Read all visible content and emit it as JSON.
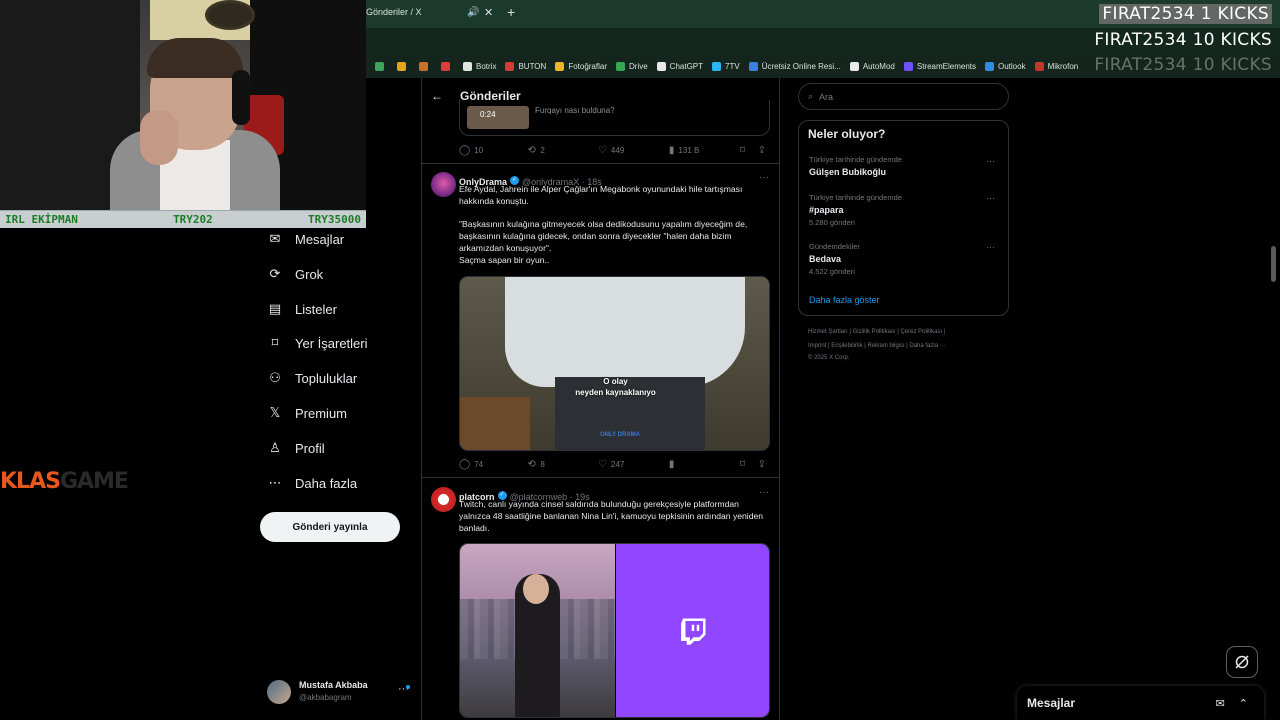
{
  "browser": {
    "tab_title": "Gönderiler / X",
    "tab_audio": "🔊",
    "tab_close": "✕",
    "tab_new": "+",
    "bookmarks": [
      {
        "label": "",
        "color": "#3ba55d"
      },
      {
        "label": "",
        "color": "#e7a21b"
      },
      {
        "label": "",
        "color": "#c9702a"
      },
      {
        "label": "",
        "color": "#e23b3b"
      },
      {
        "label": "Botrix",
        "color": "#dfe6e2"
      },
      {
        "label": "BUTON",
        "color": "#d83a3a"
      },
      {
        "label": "Fotoğraflar",
        "color": "#f0b429"
      },
      {
        "label": "Drive",
        "color": "#34a853"
      },
      {
        "label": "ChatGPT",
        "color": "#e7e9ea"
      },
      {
        "label": "7TV",
        "color": "#29b6f6"
      },
      {
        "label": "Ücretsiz Online Resi...",
        "color": "#3d7fe0"
      },
      {
        "label": "AutoMod",
        "color": "#e7e9ea"
      },
      {
        "label": "StreamElements",
        "color": "#6f52ff"
      },
      {
        "label": "Outlook",
        "color": "#2f8ce0"
      },
      {
        "label": "Mikrofon",
        "color": "#c0392b"
      }
    ]
  },
  "overlay": {
    "strip": {
      "left": "IRL EKİPMAN",
      "mid": "TRY202",
      "right": "TRY35000"
    },
    "brand_a": "KLAS",
    "brand_b": "GAME",
    "kicks": [
      "FIRAT2534  1 KICKS",
      "FIRAT2534  10 KICKS",
      "FIRAT2534  10 KICKS"
    ]
  },
  "nav": {
    "items": [
      {
        "label": "Mesajlar",
        "icon": "✉"
      },
      {
        "label": "Grok",
        "icon": "⟳"
      },
      {
        "label": "Listeler",
        "icon": "▤"
      },
      {
        "label": "Yer İşaretleri",
        "icon": "⌑"
      },
      {
        "label": "Topluluklar",
        "icon": "⚇"
      },
      {
        "label": "Premium",
        "icon": "𝕏"
      },
      {
        "label": "Profil",
        "icon": "♙"
      },
      {
        "label": "Daha fazla",
        "icon": "⋯"
      }
    ],
    "post_button": "Gönderi yayınla",
    "account": {
      "name": "Mustafa Akbaba",
      "handle": "@akbabagram",
      "more": "···"
    }
  },
  "timeline": {
    "title": "Gönderiler",
    "back": "←",
    "prev_card": {
      "duration": "0:24",
      "text": "Furqayı nası bulduna?"
    },
    "prev_actions": {
      "replies": "10",
      "reposts": "2",
      "likes": "449",
      "views": "131 B"
    },
    "tweets": [
      {
        "name": "OnlyDrama",
        "handle": "@onlydramaX · 18s",
        "text": "Efe Aydal, Jahrein ile Alper Çağlar'ın Megabonk oyunundaki hile tartışması hakkında konuştu.\n\n\"Başkasının kulağına gitmeyecek olsa dedikodusunu yapalım diyeceğim de, başkasının kulağına gidecek, ondan sonra diyecekler \"halen daha bizim arkamızdan konuşuyor\".\nSaçma sapan bir oyun..",
        "caption1": "O olay",
        "caption2": "neyden kaynaklanıyo",
        "watermark": "ONLY DRAMA",
        "replies": "74",
        "reposts": "8",
        "likes": "247",
        "views": ""
      },
      {
        "name": "platcorn",
        "handle": "@platcornweb · 19s",
        "text": "Twitch, canlı yayında cinsel saldırıda bulunduğu gerekçesiyle platformdan yalnızca 48 saatliğine banlanan Nina Lin'i, kamuoyu tepkisinin ardından yeniden banladı."
      }
    ]
  },
  "sidebar": {
    "search_placeholder": "Ara",
    "trends_title": "Neler oluyor?",
    "trends": [
      {
        "context": "Türkiye tarihinde gündemde",
        "name": "Gülşen Bubikoğlu",
        "count": ""
      },
      {
        "context": "Türkiye tarihinde gündemde",
        "name": "#papara",
        "count": "5.280 gönderi"
      },
      {
        "context": "Gündemdekiler",
        "name": "Bedava",
        "count": "4.522 gönderi"
      }
    ],
    "show_more": "Daha fazla göster",
    "footer1": "Hizmet Şartları  |  Gizlilik Politikası  |  Çerez Politikası  |",
    "footer2": "Imprint  |  Erişilebilirlik  |  Reklam bilgisi  |  Daha fazla ···",
    "footer3": "© 2025 X Corp."
  },
  "dock": {
    "messages": "Mesajlar"
  }
}
